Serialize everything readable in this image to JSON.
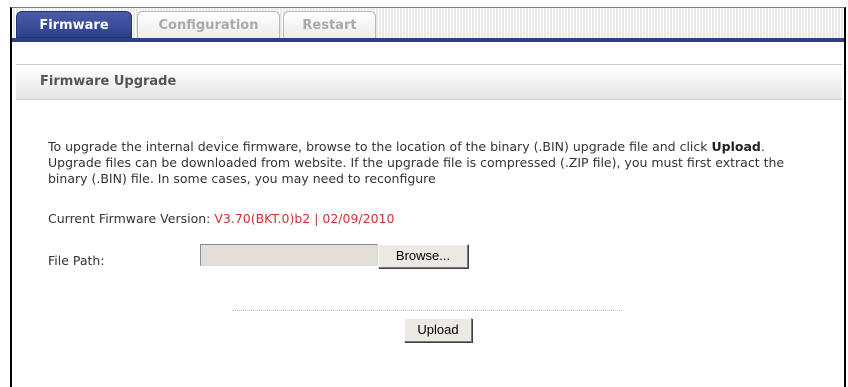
{
  "tabs": [
    {
      "label": "Firmware",
      "active": true
    },
    {
      "label": "Configuration",
      "active": false
    },
    {
      "label": "Restart",
      "active": false
    }
  ],
  "section": {
    "title": "Firmware Upgrade"
  },
  "description": {
    "part1": "To upgrade the internal device firmware, browse to the location of the binary (.BIN) upgrade file and click ",
    "bold": "Upload",
    "part2": ". Upgrade files can be downloaded from website. If the upgrade file is compressed (.ZIP file), you must first extract the binary (.BIN) file. In some cases, you may need to reconfigure"
  },
  "firmware": {
    "label": "Current Firmware Version: ",
    "value": "V3.70(BKT.0)b2 | 02/09/2010"
  },
  "file_path": {
    "label": "File Path:",
    "value": "",
    "browse_label": "Browse..."
  },
  "actions": {
    "upload_label": "Upload"
  },
  "colors": {
    "tab_active": "#2e3f8a",
    "firmware_value": "#cc3333"
  }
}
